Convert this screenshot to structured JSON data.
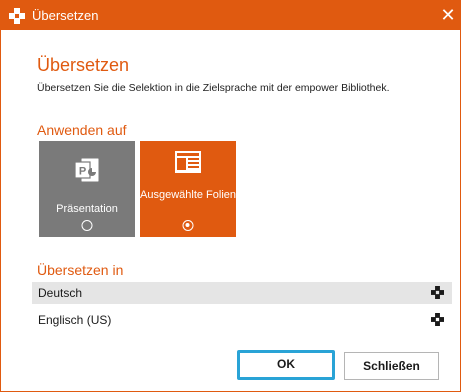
{
  "window": {
    "title": "Übersetzen",
    "close_glyph": "✕",
    "accent_color": "#e05a10",
    "app_icon": "empower-logo-icon"
  },
  "header": {
    "heading": "Übersetzen",
    "description": "Übersetzen Sie die Selektion in die Zielsprache mit der empower Bibliothek."
  },
  "apply_to": {
    "label": "Anwenden auf",
    "options": [
      {
        "label": "Präsentation",
        "icon": "powerpoint-icon",
        "selected": false
      },
      {
        "label": "Ausgewählte Folien",
        "icon": "slides-icon",
        "selected": true
      }
    ]
  },
  "translate_into": {
    "label": "Übersetzen in",
    "languages": [
      {
        "name": "Deutsch",
        "icon": "empower-logo-icon",
        "selected": true
      },
      {
        "name": "Englisch (US)",
        "icon": "empower-logo-icon",
        "selected": false
      }
    ]
  },
  "buttons": {
    "ok": "OK",
    "close": "Schließen"
  }
}
